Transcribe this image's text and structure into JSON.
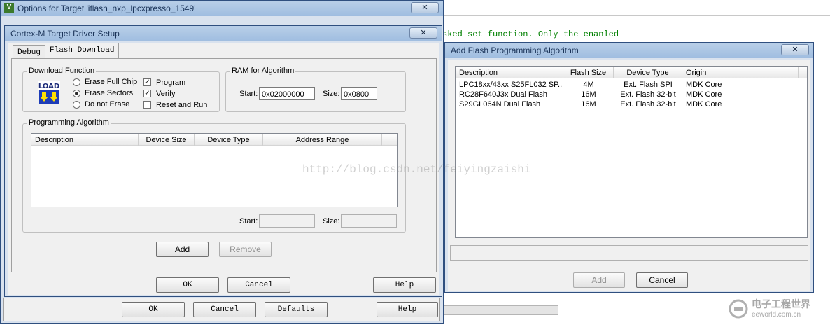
{
  "editor": {
    "code_line": "sked set function. Only the enanled"
  },
  "options_window": {
    "title": "Options for Target 'iflash_nxp_lpcxpresso_1549'",
    "close": "✕",
    "buttons": {
      "ok": "OK",
      "cancel": "Cancel",
      "defaults": "Defaults",
      "help": "Help"
    }
  },
  "driver_window": {
    "title": "Cortex-M Target Driver Setup",
    "close": "✕",
    "tabs": [
      "Debug",
      "Flash Download"
    ],
    "download_function": {
      "title": "Download Function",
      "radios": [
        {
          "label": "Erase Full Chip",
          "selected": false
        },
        {
          "label": "Erase Sectors",
          "selected": true
        },
        {
          "label": "Do not Erase",
          "selected": false
        }
      ],
      "checks": [
        {
          "label": "Program",
          "checked": true
        },
        {
          "label": "Verify",
          "checked": true
        },
        {
          "label": "Reset and Run",
          "checked": false
        }
      ],
      "icon_text": "LOAD"
    },
    "ram": {
      "title": "RAM for Algorithm",
      "start_label": "Start:",
      "start_value": "0x02000000",
      "size_label": "Size:",
      "size_value": "0x0800"
    },
    "algorithm": {
      "title": "Programming Algorithm",
      "columns": [
        "Description",
        "Device Size",
        "Device Type",
        "Address Range"
      ],
      "start_label": "Start:",
      "size_label": "Size:"
    },
    "buttons": {
      "add": "Add",
      "remove": "Remove",
      "ok": "OK",
      "cancel": "Cancel",
      "help": "Help"
    }
  },
  "add_window": {
    "title": "Add Flash Programming Algorithm",
    "close": "✕",
    "columns": [
      "Description",
      "Flash Size",
      "Device Type",
      "Origin"
    ],
    "rows": [
      {
        "description": "LPC18xx/43xx S25FL032 SP...",
        "flash_size": "4M",
        "device_type": "Ext. Flash SPI",
        "origin": "MDK Core"
      },
      {
        "description": "RC28F640J3x Dual Flash",
        "flash_size": "16M",
        "device_type": "Ext. Flash 32-bit",
        "origin": "MDK Core"
      },
      {
        "description": "S29GL064N Dual Flash",
        "flash_size": "16M",
        "device_type": "Ext. Flash 32-bit",
        "origin": "MDK Core"
      }
    ],
    "buttons": {
      "add": "Add",
      "cancel": "Cancel"
    }
  },
  "watermark": "http://blog.csdn.net/feiyingzaishi",
  "brand": {
    "name": "电子工程世界",
    "domain": "eeworld.com.cn"
  }
}
